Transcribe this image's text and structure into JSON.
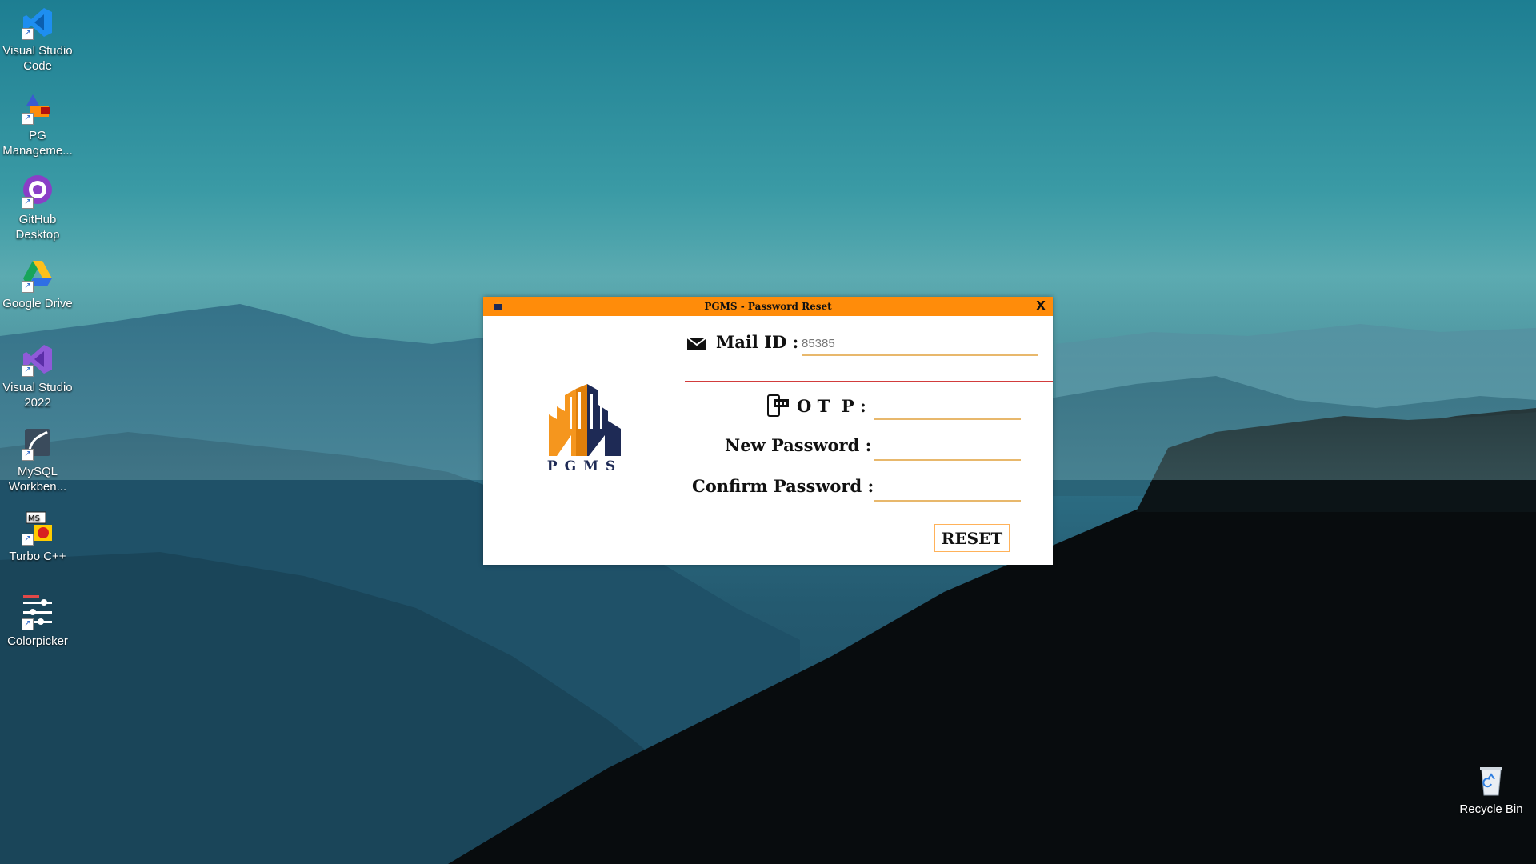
{
  "desktop": {
    "icons": [
      {
        "label": "Visual Studio\nCode",
        "icon": "vscode-icon"
      },
      {
        "label": "PG\nManageme...",
        "icon": "pg-management-icon"
      },
      {
        "label": "GitHub\nDesktop",
        "icon": "github-desktop-icon"
      },
      {
        "label": "Google Drive",
        "icon": "google-drive-icon"
      },
      {
        "label": "Visual Studio\n2022",
        "icon": "visual-studio-icon"
      },
      {
        "label": "MySQL\nWorkben...",
        "icon": "mysql-workbench-icon"
      },
      {
        "label": "Turbo C++",
        "icon": "turbo-cpp-icon"
      },
      {
        "label": "Colorpicker",
        "icon": "colorpicker-icon"
      }
    ],
    "recycle_bin": {
      "label": "Recycle Bin",
      "icon": "recycle-bin-icon"
    }
  },
  "dialog": {
    "title": "PGMS - Password Reset",
    "close_label": "X",
    "logo_text": "PGMS",
    "mail_label": "Mail ID :",
    "mail_value": "85385",
    "otp_label": "O T  P :",
    "otp_value": "",
    "new_password_label": "New Password :",
    "confirm_password_label": "Confirm Password :",
    "reset_label": "RESET",
    "colors": {
      "titlebar": "#ff8c0a",
      "accent_line": "#d23c3c",
      "logo_orange": "#f5961e",
      "logo_navy": "#1e2a55"
    }
  }
}
